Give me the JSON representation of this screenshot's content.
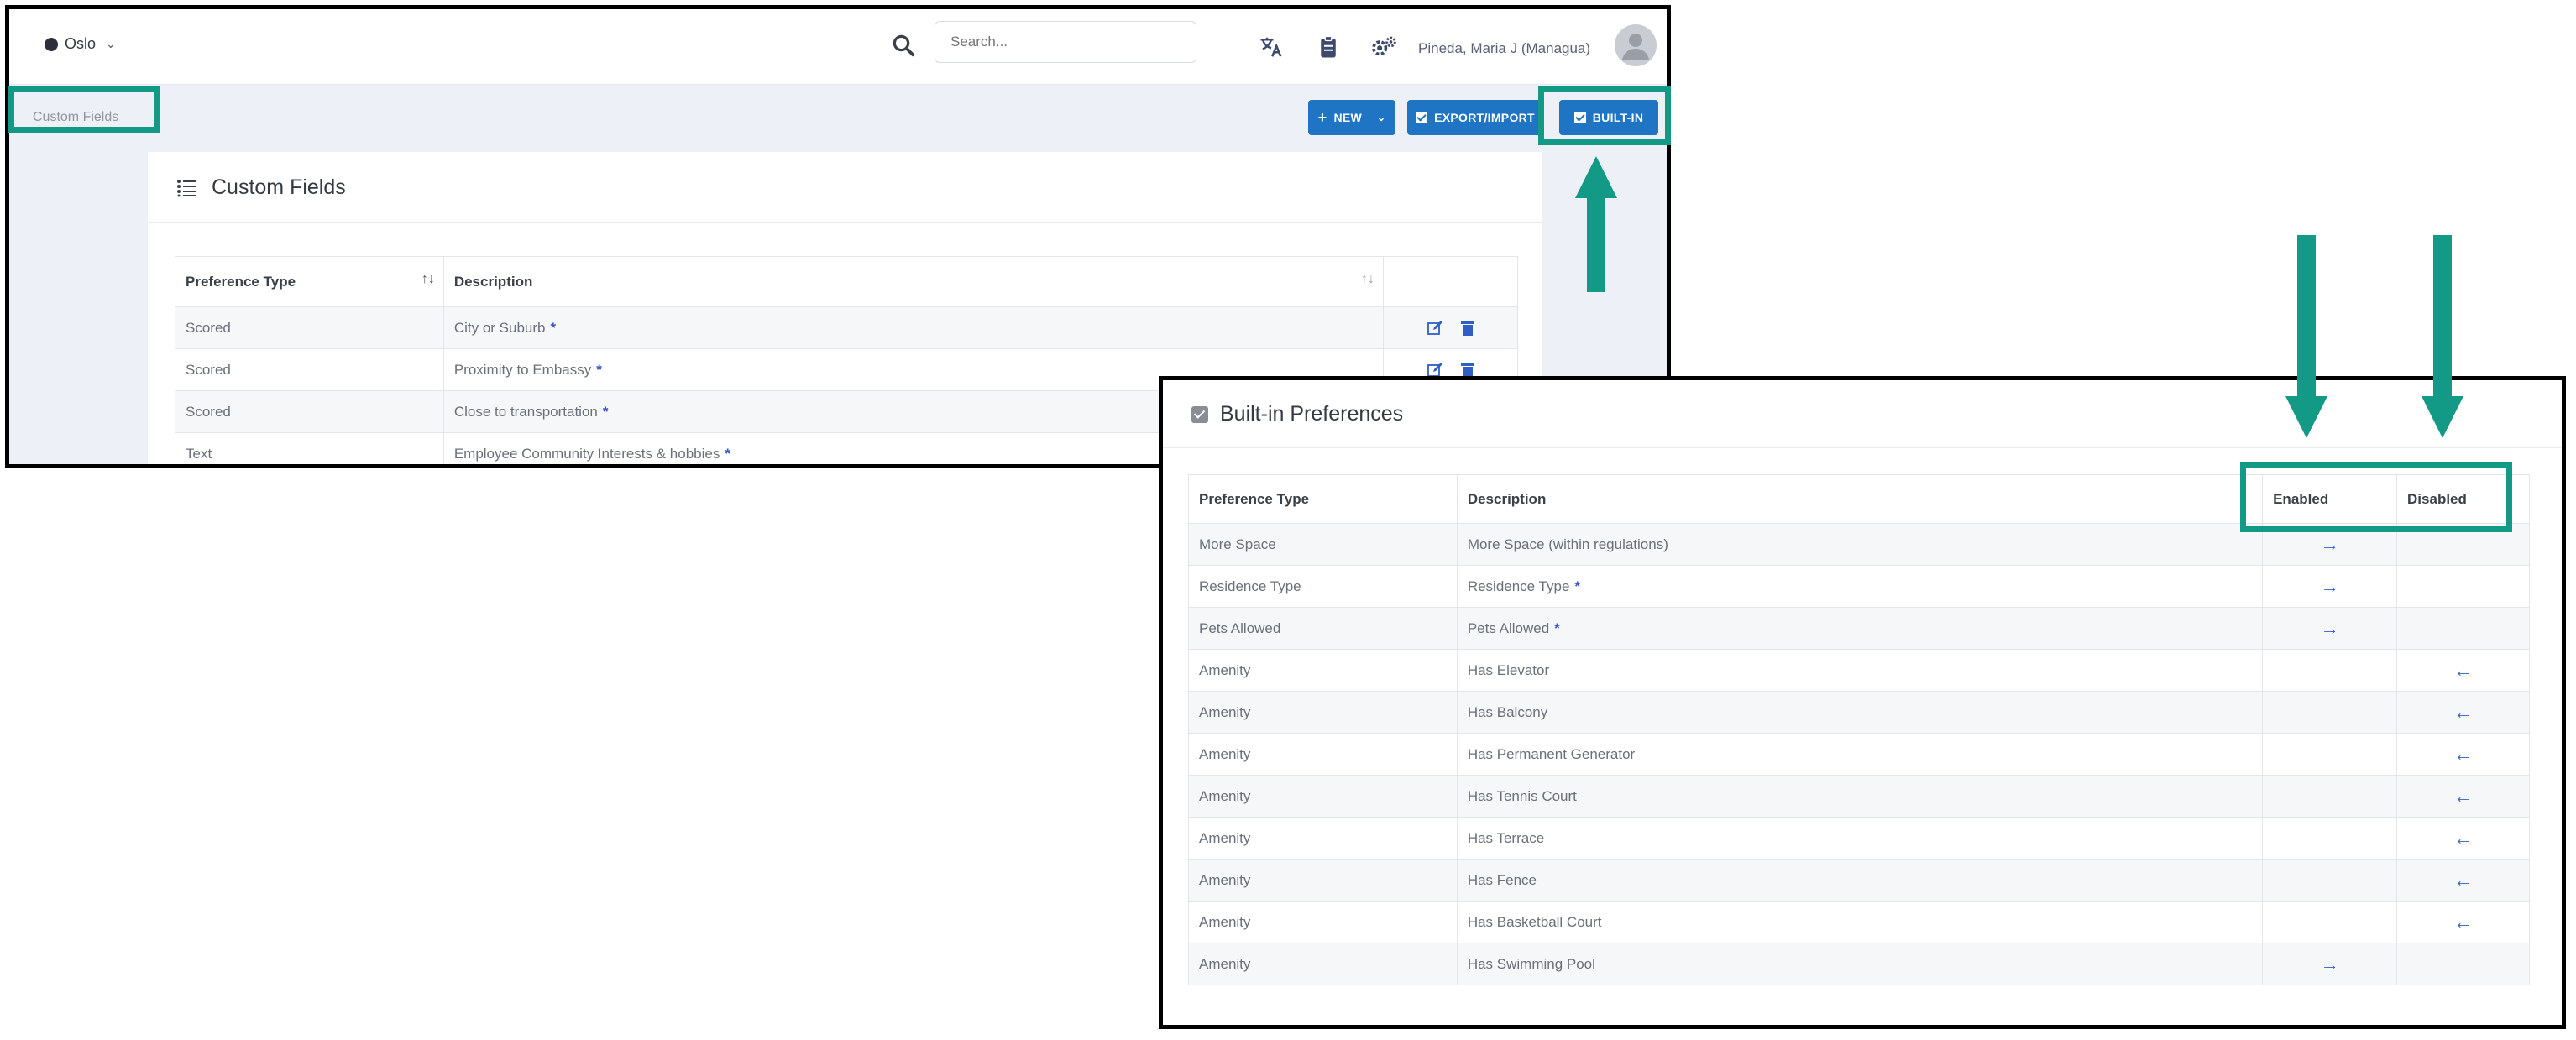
{
  "topbar": {
    "location": "Oslo",
    "search_placeholder": "Search...",
    "user_name": "Pineda, Maria J (Managua)"
  },
  "breadcrumb": "Custom Fields",
  "toolbar": {
    "new_label": "NEW",
    "export_import_label": "EXPORT/IMPORT",
    "built_in_label": "BUILT-IN"
  },
  "custom_fields": {
    "title": "Custom Fields",
    "columns": [
      "Preference Type",
      "Description"
    ],
    "rows": [
      {
        "type": "Scored",
        "description": "City or Suburb",
        "required": "*"
      },
      {
        "type": "Scored",
        "description": "Proximity to Embassy",
        "required": "*"
      },
      {
        "type": "Scored",
        "description": "Close to transportation",
        "required": "*"
      },
      {
        "type": "Text",
        "description": "Employee Community Interests & hobbies",
        "required": "*"
      }
    ]
  },
  "built_in": {
    "title": "Built-in Preferences",
    "columns": [
      "Preference Type",
      "Description",
      "Enabled",
      "Disabled"
    ],
    "rows": [
      {
        "type": "More Space",
        "description": "More Space (within regulations)",
        "required": "",
        "state": "enabled"
      },
      {
        "type": "Residence Type",
        "description": "Residence Type",
        "required": "*",
        "state": "enabled"
      },
      {
        "type": "Pets Allowed",
        "description": "Pets Allowed",
        "required": "*",
        "state": "enabled"
      },
      {
        "type": "Amenity",
        "description": "Has Elevator",
        "required": "",
        "state": "disabled"
      },
      {
        "type": "Amenity",
        "description": "Has Balcony",
        "required": "",
        "state": "disabled"
      },
      {
        "type": "Amenity",
        "description": "Has Permanent Generator",
        "required": "",
        "state": "disabled"
      },
      {
        "type": "Amenity",
        "description": "Has Tennis Court",
        "required": "",
        "state": "disabled"
      },
      {
        "type": "Amenity",
        "description": "Has Terrace",
        "required": "",
        "state": "disabled"
      },
      {
        "type": "Amenity",
        "description": "Has Fence",
        "required": "",
        "state": "disabled"
      },
      {
        "type": "Amenity",
        "description": "Has Basketball Court",
        "required": "",
        "state": "disabled"
      },
      {
        "type": "Amenity",
        "description": "Has Swimming Pool",
        "required": "",
        "state": "enabled"
      }
    ]
  },
  "colors": {
    "accent": "#1f74c4",
    "annotation": "#139a86",
    "link_icon": "#2f5fc3"
  }
}
